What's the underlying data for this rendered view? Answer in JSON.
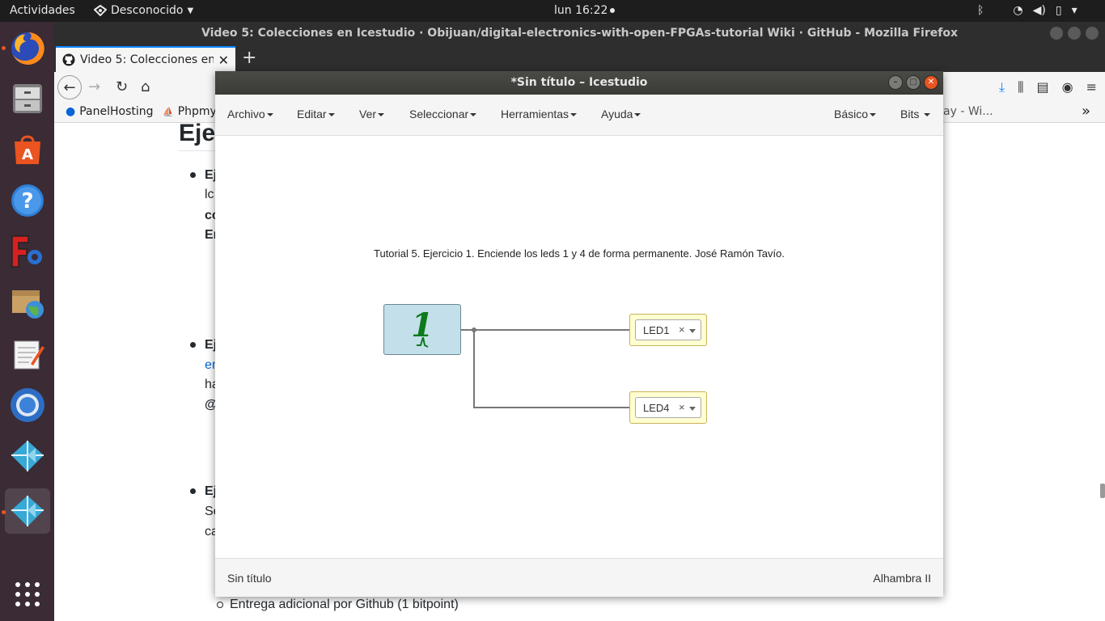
{
  "topbar": {
    "activities": "Actividades",
    "network": "Desconocido",
    "clock": "lun 16:22",
    "tray_icons": [
      "bluetooth-icon",
      "wifi-icon",
      "volume-icon",
      "battery-icon",
      "power-menu-icon"
    ]
  },
  "dock": {
    "items": [
      {
        "name": "firefox",
        "icon": "firefox-icon"
      },
      {
        "name": "files",
        "icon": "file-manager-icon"
      },
      {
        "name": "software",
        "icon": "software-center-icon"
      },
      {
        "name": "help",
        "icon": "help-icon"
      },
      {
        "name": "freecad",
        "icon": "freecad-icon"
      },
      {
        "name": "archive",
        "icon": "archive-manager-icon"
      },
      {
        "name": "text-editor",
        "icon": "text-editor-icon"
      },
      {
        "name": "chromium",
        "icon": "chromium-icon"
      },
      {
        "name": "icestudio",
        "icon": "icestudio-icon"
      },
      {
        "name": "icestudio-running",
        "icon": "icestudio-icon"
      }
    ],
    "show_apps_icon": "show-apps-icon"
  },
  "firefox": {
    "window_title": "Video 5: Colecciones en Icestudio · Obijuan/digital-electronics-with-open-FPGAs-tutorial Wiki · GitHub - Mozilla Firefox",
    "tab_title": "Video 5: Colecciones en I",
    "bookmarks": [
      "PanelHosting",
      "Phpmy",
      "ay - Wi..."
    ]
  },
  "page": {
    "heading": "Eje",
    "item1": {
      "line1": "Ej",
      "line2": "lc",
      "line3": "cc",
      "line4": "En"
    },
    "item2": {
      "line1": "Ej",
      "line2": "en",
      "line3": "ha",
      "line4": "@"
    },
    "item3": {
      "line1": "Ej",
      "line2": "Se",
      "line3": "ca"
    },
    "sub_item": "Entrega adicional por Github (1 bitpoint)"
  },
  "icestudio": {
    "window_title": "*Sin título – Icestudio",
    "menus": [
      "Archivo",
      "Editar",
      "Ver",
      "Seleccionar",
      "Herramientas",
      "Ayuda"
    ],
    "right_menus": [
      "Básico",
      "Bits"
    ],
    "info_text": "Tutorial 5. Ejercicio 1. Enciende los leds 1 y 4 de forma permanente. José Ramón Tavío.",
    "constant_value": "1",
    "leds": [
      {
        "label": "LED1",
        "clear": "×"
      },
      {
        "label": "LED4",
        "clear": "×"
      }
    ],
    "status_left": "Sin título",
    "status_right": "Alhambra II",
    "colors": {
      "constant_block": "#c3dfe9",
      "constant_text": "#0d7a1c",
      "led_block": "#ffffd1"
    }
  }
}
